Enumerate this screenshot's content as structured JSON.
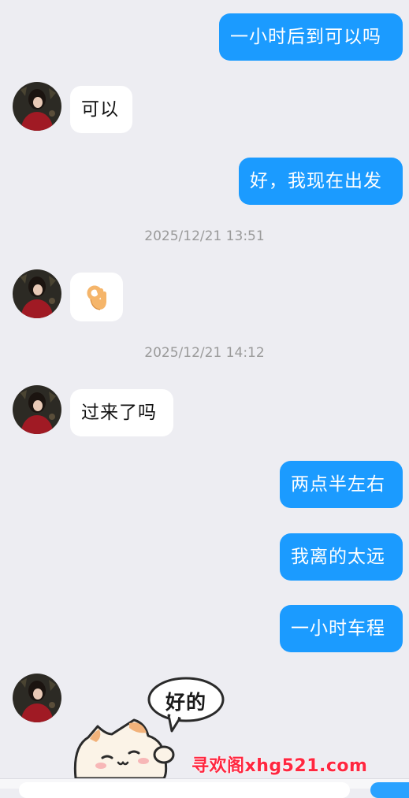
{
  "messages": [
    {
      "sender": "me",
      "text": "一小时后到可以吗"
    },
    {
      "sender": "them",
      "text": "可以"
    },
    {
      "sender": "me",
      "text": "好，我现在出发"
    },
    {
      "sender": "timestamp",
      "text": "2025/12/21 13:51"
    },
    {
      "sender": "them",
      "emoji": "ok-hand-emoji"
    },
    {
      "sender": "timestamp",
      "text": "2025/12/21 14:12"
    },
    {
      "sender": "them",
      "text": "过来了吗"
    },
    {
      "sender": "me",
      "text": "两点半左右"
    },
    {
      "sender": "me",
      "text": "我离的太远"
    },
    {
      "sender": "me",
      "text": "一小时车程"
    },
    {
      "sender": "them",
      "sticker": "cat-sticker",
      "sticker_text": "好的"
    }
  ],
  "watermark": "寻欢阁xhg521.com",
  "colors": {
    "background": "#ededf2",
    "my_bubble": "#1b9bff",
    "their_bubble": "#ffffff",
    "timestamp": "#9a9a9a",
    "watermark": "#ff2740"
  }
}
